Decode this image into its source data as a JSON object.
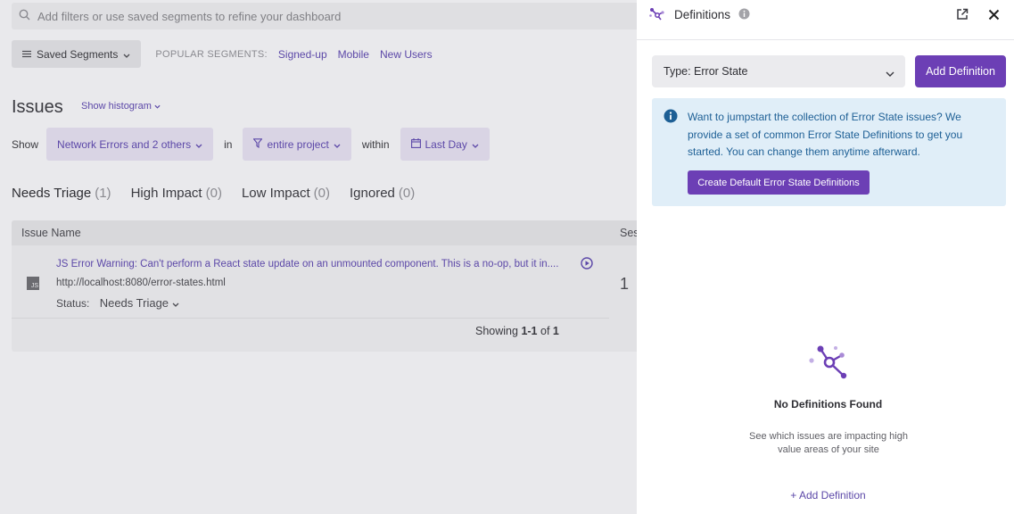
{
  "search": {
    "placeholder": "Add filters or use saved segments to refine your dashboard"
  },
  "segments": {
    "saved_label": "Saved Segments",
    "popular_label": "POPULAR SEGMENTS:",
    "popular": [
      "Signed-up",
      "Mobile",
      "New Users"
    ]
  },
  "issues": {
    "title": "Issues",
    "histogram_label": "Show histogram",
    "filter": {
      "show_label": "Show",
      "types_value": "Network Errors and 2 others",
      "in_label": "in",
      "scope_value": "entire project",
      "within_label": "within",
      "time_value": "Last Day"
    },
    "tabs": [
      {
        "label": "Needs Triage",
        "count": "(1)"
      },
      {
        "label": "High Impact",
        "count": "(0)"
      },
      {
        "label": "Low Impact",
        "count": "(0)"
      },
      {
        "label": "Ignored",
        "count": "(0)"
      }
    ],
    "table": {
      "col_issue_name": "Issue Name",
      "col_sessions": "Ses",
      "rows": [
        {
          "badge": "JS",
          "title": "JS Error Warning: Can't perform a React state update on an unmounted component. This is a no-op, but it in....",
          "url": "http://localhost:8080/error-states.html",
          "status_label": "Status:",
          "status_value": "Needs Triage",
          "sessions": "1"
        }
      ],
      "showing_prefix": "Showing",
      "showing_range": "1-1",
      "showing_of": "of",
      "showing_total": "1"
    }
  },
  "panel": {
    "title": "Definitions",
    "type_select_value": "Type: Error State",
    "add_button": "Add Definition",
    "info_text": "Want to jumpstart the collection of Error State issues? We provide a set of common Error State Definitions to get you started. You can change them anytime afterward.",
    "default_button": "Create Default Error State Definitions",
    "empty_title": "No Definitions Found",
    "empty_desc": "See which issues are impacting high value areas of your site",
    "add_link": "+ Add Definition"
  },
  "colors": {
    "accent": "#6c3fb5",
    "link": "#5c48a8",
    "info_bg": "#e0eef8",
    "info_text": "#1d5f95"
  }
}
